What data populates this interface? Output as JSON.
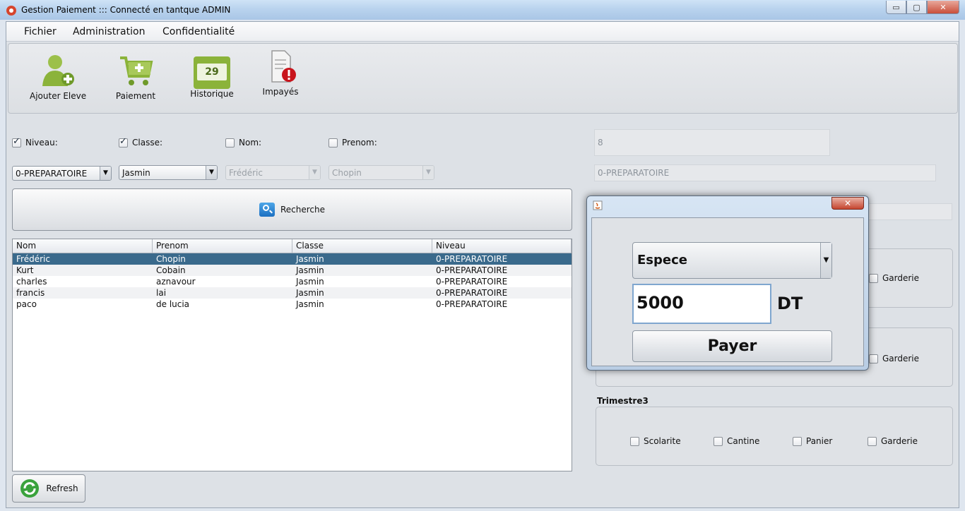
{
  "window": {
    "title": "Gestion Paiement ::: Connecté en tantque ADMIN",
    "minimize_label": "▭",
    "maximize_label": "▢",
    "close_label": "✕"
  },
  "menu": {
    "items": [
      "Fichier",
      "Administration",
      "Confidentialité"
    ]
  },
  "toolbar": {
    "buttons": [
      {
        "label": "Ajouter Eleve",
        "icon": "add-user-icon"
      },
      {
        "label": "Paiement",
        "icon": "cart-icon"
      },
      {
        "label": "Historique",
        "icon": "calendar-icon",
        "badge": "29"
      },
      {
        "label": "Impayés",
        "icon": "document-warning-icon"
      }
    ]
  },
  "filters": {
    "checkboxes": [
      {
        "label": "Niveau:",
        "checked": true
      },
      {
        "label": "Classe:",
        "checked": true
      },
      {
        "label": "Nom:",
        "checked": false
      },
      {
        "label": "Prenom:",
        "checked": false
      }
    ],
    "combos": [
      {
        "value": "0-PREPARATOIRE",
        "enabled": true
      },
      {
        "value": "Jasmin",
        "enabled": true
      },
      {
        "value": "Frédéric",
        "enabled": false
      },
      {
        "value": "Chopin",
        "enabled": false
      }
    ],
    "search_label": "Recherche"
  },
  "table": {
    "columns": [
      "Nom",
      "Prenom",
      "Classe",
      "Niveau"
    ],
    "rows": [
      [
        "Frédéric",
        "Chopin",
        "Jasmin",
        "0-PREPARATOIRE"
      ],
      [
        "Kurt",
        "Cobain",
        "Jasmin",
        "0-PREPARATOIRE"
      ],
      [
        "charles",
        "aznavour",
        "Jasmin",
        "0-PREPARATOIRE"
      ],
      [
        "francis",
        "lai",
        "Jasmin",
        "0-PREPARATOIRE"
      ],
      [
        "paco",
        "de lucia",
        "Jasmin",
        "0-PREPARATOIRE"
      ]
    ],
    "selected_row": 0
  },
  "refresh_label": "Refresh",
  "details": {
    "id_value": "8",
    "niveau_value": "0-PREPARATOIRE",
    "trimestre3_label": "Trimestre3",
    "options": [
      "Scolarite",
      "Cantine",
      "Panier",
      "Garderie"
    ],
    "garderie_label": "Garderie"
  },
  "dialog": {
    "mode": "Espece",
    "amount": "5000",
    "currency": "DT",
    "pay_label": "Payer",
    "close_label": "✕"
  },
  "colors": {
    "selection": "#3a6a8c",
    "accent_green": "#8bb33a"
  }
}
